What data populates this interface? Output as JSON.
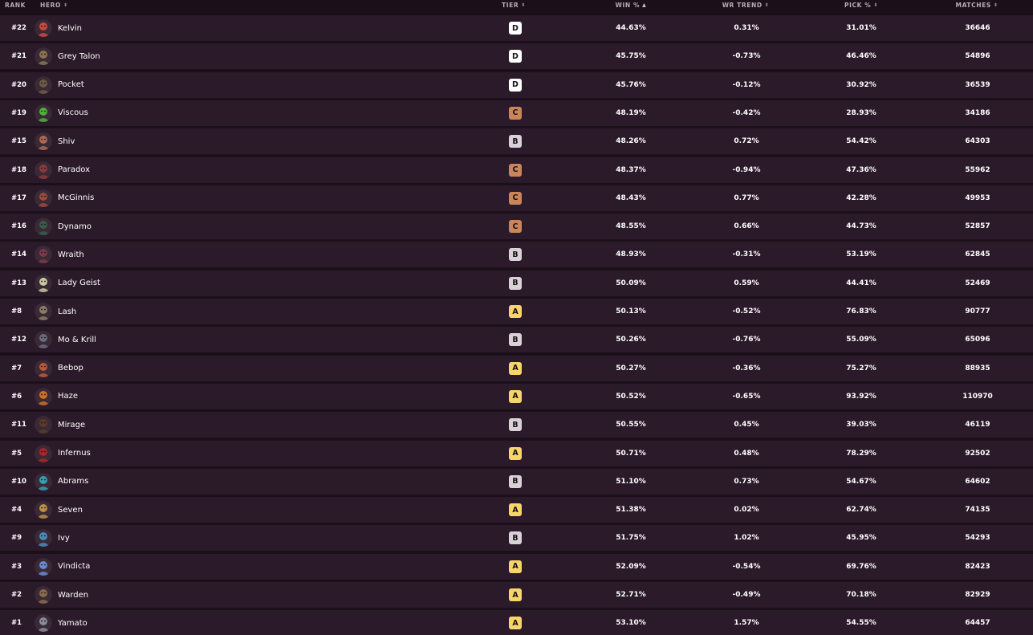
{
  "columns": {
    "rank": "RANK",
    "hero": "HERO",
    "tier": "TIER",
    "win": "WIN %",
    "trend": "WR TREND",
    "pick": "PICK %",
    "matches": "MATCHES"
  },
  "sort": {
    "column": "win",
    "direction": "ascending"
  },
  "sort_icons": {
    "neutral": "⬍",
    "ascending": "▲"
  },
  "tier_colors": {
    "A": "#f6d66a",
    "B": "#d8d2d6",
    "C": "#c8865a",
    "D": "#ffffff"
  },
  "rows": [
    {
      "rank": "#22",
      "hero": "Kelvin",
      "tier": "D",
      "win": "44.63%",
      "trend": "0.31%",
      "pick": "31.01%",
      "matches": "36646",
      "avatar_color": "#c44a3e"
    },
    {
      "rank": "#21",
      "hero": "Grey Talon",
      "tier": "D",
      "win": "45.75%",
      "trend": "-0.73%",
      "pick": "46.46%",
      "matches": "54896",
      "avatar_color": "#8a7350"
    },
    {
      "rank": "#20",
      "hero": "Pocket",
      "tier": "D",
      "win": "45.76%",
      "trend": "-0.12%",
      "pick": "30.92%",
      "matches": "36539",
      "avatar_color": "#6b5a45"
    },
    {
      "rank": "#19",
      "hero": "Viscous",
      "tier": "C",
      "win": "48.19%",
      "trend": "-0.42%",
      "pick": "28.93%",
      "matches": "34186",
      "avatar_color": "#4fb03c"
    },
    {
      "rank": "#15",
      "hero": "Shiv",
      "tier": "B",
      "win": "48.26%",
      "trend": "0.72%",
      "pick": "54.42%",
      "matches": "64303",
      "avatar_color": "#a86a55"
    },
    {
      "rank": "#18",
      "hero": "Paradox",
      "tier": "C",
      "win": "48.37%",
      "trend": "-0.94%",
      "pick": "47.36%",
      "matches": "55962",
      "avatar_color": "#8a3a3a"
    },
    {
      "rank": "#17",
      "hero": "McGinnis",
      "tier": "C",
      "win": "48.43%",
      "trend": "0.77%",
      "pick": "42.28%",
      "matches": "49953",
      "avatar_color": "#9a4a3a"
    },
    {
      "rank": "#16",
      "hero": "Dynamo",
      "tier": "C",
      "win": "48.55%",
      "trend": "0.66%",
      "pick": "44.73%",
      "matches": "52857",
      "avatar_color": "#3a5a4a"
    },
    {
      "rank": "#14",
      "hero": "Wraith",
      "tier": "B",
      "win": "48.93%",
      "trend": "-0.31%",
      "pick": "53.19%",
      "matches": "62845",
      "avatar_color": "#7a3a4a"
    },
    {
      "rank": "#13",
      "hero": "Lady Geist",
      "tier": "B",
      "win": "50.09%",
      "trend": "0.59%",
      "pick": "44.41%",
      "matches": "52469",
      "avatar_color": "#c8c8a0"
    },
    {
      "rank": "#8",
      "hero": "Lash",
      "tier": "A",
      "win": "50.13%",
      "trend": "-0.52%",
      "pick": "76.83%",
      "matches": "90777",
      "avatar_color": "#8a7a6a"
    },
    {
      "rank": "#12",
      "hero": "Mo & Krill",
      "tier": "B",
      "win": "50.26%",
      "trend": "-0.76%",
      "pick": "55.09%",
      "matches": "65096",
      "avatar_color": "#6a6a7a"
    },
    {
      "rank": "#7",
      "hero": "Bebop",
      "tier": "A",
      "win": "50.27%",
      "trend": "-0.36%",
      "pick": "75.27%",
      "matches": "88935",
      "avatar_color": "#b85a3a"
    },
    {
      "rank": "#6",
      "hero": "Haze",
      "tier": "A",
      "win": "50.52%",
      "trend": "-0.65%",
      "pick": "93.92%",
      "matches": "110970",
      "avatar_color": "#c8702a"
    },
    {
      "rank": "#11",
      "hero": "Mirage",
      "tier": "B",
      "win": "50.55%",
      "trend": "0.45%",
      "pick": "39.03%",
      "matches": "46119",
      "avatar_color": "#5a3a2a"
    },
    {
      "rank": "#5",
      "hero": "Infernus",
      "tier": "A",
      "win": "50.71%",
      "trend": "0.48%",
      "pick": "78.29%",
      "matches": "92502",
      "avatar_color": "#a02a2a"
    },
    {
      "rank": "#10",
      "hero": "Abrams",
      "tier": "B",
      "win": "51.10%",
      "trend": "0.73%",
      "pick": "54.67%",
      "matches": "64602",
      "avatar_color": "#3a9ab0"
    },
    {
      "rank": "#4",
      "hero": "Seven",
      "tier": "A",
      "win": "51.38%",
      "trend": "0.02%",
      "pick": "62.74%",
      "matches": "74135",
      "avatar_color": "#b8904a"
    },
    {
      "rank": "#9",
      "hero": "Ivy",
      "tier": "B",
      "win": "51.75%",
      "trend": "1.02%",
      "pick": "45.95%",
      "matches": "54293",
      "avatar_color": "#4a8ab8"
    },
    {
      "rank": "#3",
      "hero": "Vindicta",
      "tier": "A",
      "win": "52.09%",
      "trend": "-0.54%",
      "pick": "69.76%",
      "matches": "82423",
      "avatar_color": "#6a8ad0"
    },
    {
      "rank": "#2",
      "hero": "Warden",
      "tier": "A",
      "win": "52.71%",
      "trend": "-0.49%",
      "pick": "70.18%",
      "matches": "82929",
      "avatar_color": "#8a6a4a"
    },
    {
      "rank": "#1",
      "hero": "Yamato",
      "tier": "A",
      "win": "53.10%",
      "trend": "1.57%",
      "pick": "54.55%",
      "matches": "64457",
      "avatar_color": "#8a8a9a"
    }
  ]
}
